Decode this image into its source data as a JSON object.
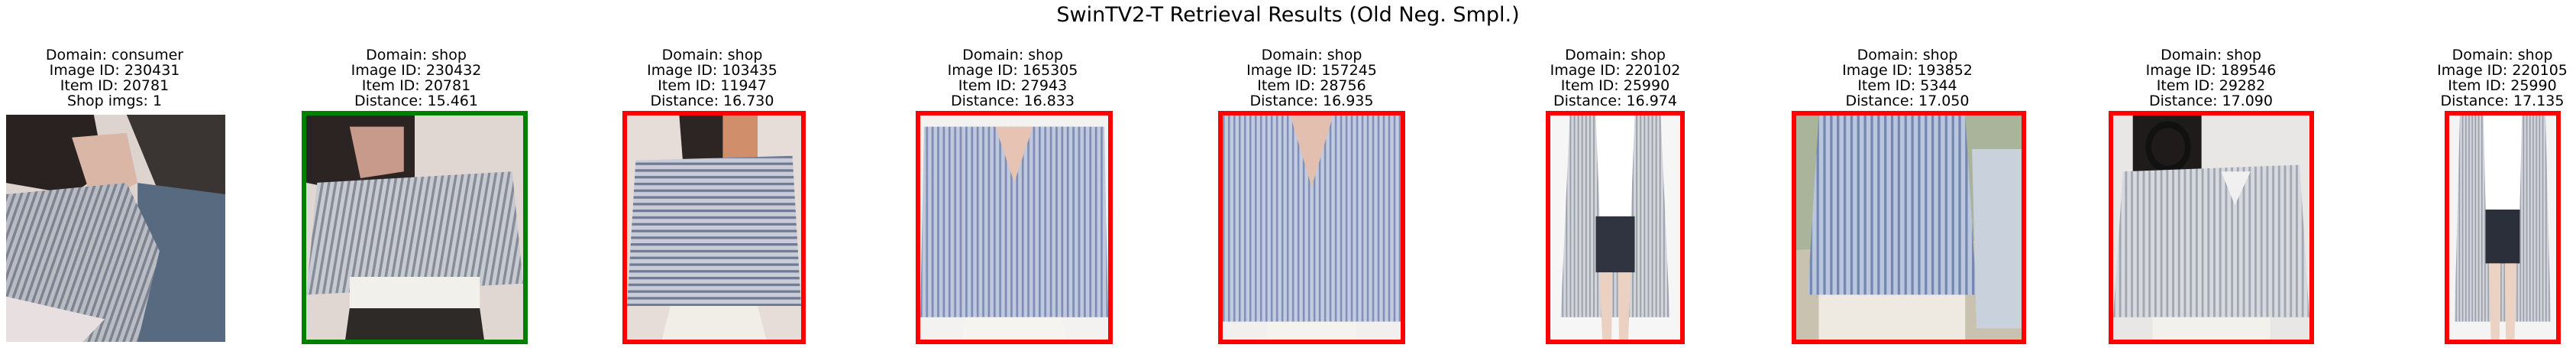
{
  "figure": {
    "title": "SwinTV2-T Retrieval Results (Old Neg. Smpl.)"
  },
  "border_colors": {
    "match": "#008000",
    "nonmatch": "#ff0000"
  },
  "panels": [
    {
      "domain_line": "Domain: consumer",
      "image_id_line": "Image ID: 230431",
      "item_id_line": "Item ID: 20781",
      "extra_line": "Shop imgs: 1",
      "border": "none",
      "photo": "woman in grey striped blouse, two people close together"
    },
    {
      "domain_line": "Domain: shop",
      "image_id_line": "Image ID: 230432",
      "item_id_line": "Item ID: 20781",
      "extra_line": "Distance: 15.461",
      "border": "match",
      "photo": "woman in grey striped top with ruffled sleeves and embellished belt"
    },
    {
      "domain_line": "Domain: shop",
      "image_id_line": "Image ID: 103435",
      "item_id_line": "Item ID: 11947",
      "extra_line": "Distance: 16.730",
      "border": "nonmatch",
      "photo": "woman in blue striped t-shirt taking mirror selfie"
    },
    {
      "domain_line": "Domain: shop",
      "image_id_line": "Image ID: 165305",
      "item_id_line": "Item ID: 27943",
      "extra_line": "Distance: 16.833",
      "border": "nonmatch",
      "photo": "blue striped v-neck blouse"
    },
    {
      "domain_line": "Domain: shop",
      "image_id_line": "Image ID: 157245",
      "item_id_line": "Item ID: 28756",
      "extra_line": "Distance: 16.935",
      "border": "nonmatch",
      "photo": "blue striped blouse with v-neck"
    },
    {
      "domain_line": "Domain: shop",
      "image_id_line": "Image ID: 220102",
      "item_id_line": "Item ID: 25990",
      "extra_line": "Distance: 16.974",
      "border": "nonmatch",
      "photo": "woman in long grey striped cardigan and dark shorts"
    },
    {
      "domain_line": "Domain: shop",
      "image_id_line": "Image ID: 193852",
      "item_id_line": "Item ID: 5344",
      "extra_line": "Distance: 17.050",
      "border": "nonmatch",
      "photo": "man in blue striped shirt next to a woman"
    },
    {
      "domain_line": "Domain: shop",
      "image_id_line": "Image ID: 189546",
      "item_id_line": "Item ID: 29282",
      "extra_line": "Distance: 17.090",
      "border": "nonmatch",
      "photo": "woman with headphones in grey striped ruffle blouse"
    },
    {
      "domain_line": "Domain: shop",
      "image_id_line": "Image ID: 220105",
      "item_id_line": "Item ID: 25990",
      "extra_line": "Distance: 17.135",
      "border": "nonmatch",
      "photo": "woman in long grey striped cardigan over white top"
    }
  ]
}
